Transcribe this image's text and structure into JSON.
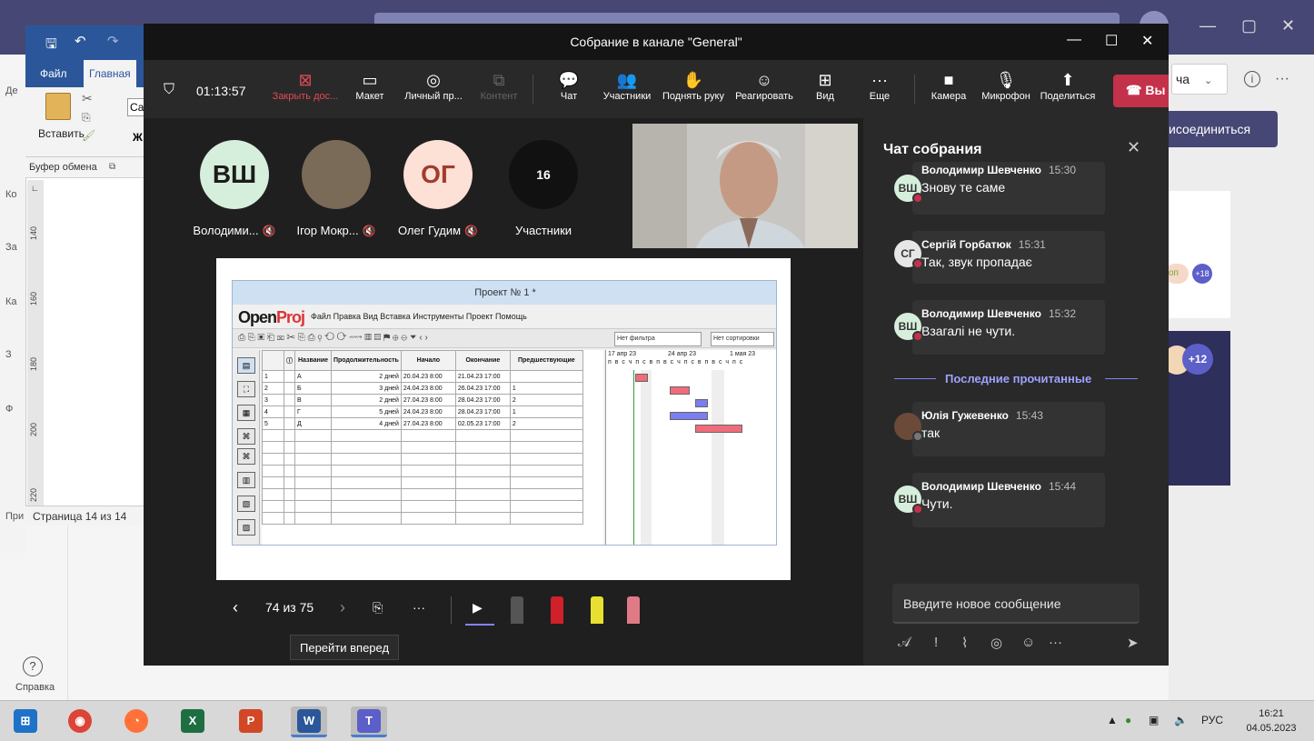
{
  "meeting": {
    "title": "Собрание в канале \"General\"",
    "timer": "01:13:57",
    "toolbar": {
      "stop_presenting": "Закрыть дос...",
      "layout": "Макет",
      "personal": "Личный пр...",
      "content": "Контент",
      "chat": "Чат",
      "participants": "Участники",
      "raise_hand": "Поднять руку",
      "react": "Реагировать",
      "view": "Вид",
      "more": "Еще",
      "camera": "Камера",
      "mic": "Микрофон",
      "share": "Поделиться",
      "leave": "Вы"
    },
    "participants": [
      {
        "initials": "ВШ",
        "name": "Володими...",
        "color": "#d6efdc",
        "text_color": "#1c1c1c"
      },
      {
        "initials": "",
        "name": "Ігор Мокр...",
        "color": "#7a6a58",
        "text_color": "#fff"
      },
      {
        "initials": "ОГ",
        "name": "Олег Гудим",
        "color": "#fde0d6",
        "text_color": "#a33b2a"
      },
      {
        "initials": "16",
        "name": "Участники",
        "color": "#111111",
        "text_color": "#fff"
      }
    ],
    "slide_nav": {
      "position": "74 из 75",
      "tooltip": "Перейти вперед"
    }
  },
  "openproj": {
    "title": "Проект № 1 *",
    "logo_a": "Open",
    "logo_b": "Proj",
    "menu": "Файл  Правка  Вид  Вставка  Инструменты  Проект  Помощь",
    "filter": "Нет фильтра",
    "sort": "Нет сортировки",
    "columns": [
      "",
      "ⓘ",
      "Название",
      "Продолжительность",
      "Начало",
      "Окончание",
      "Предшествующие"
    ],
    "rows": [
      [
        "1",
        "",
        "А",
        "2 дней",
        "20.04.23 8:00",
        "21.04.23 17:00",
        ""
      ],
      [
        "2",
        "",
        "Б",
        "3 дней",
        "24.04.23 8:00",
        "26.04.23 17:00",
        "1"
      ],
      [
        "3",
        "",
        "В",
        "2 дней",
        "27.04.23 8:00",
        "28.04.23 17:00",
        "2"
      ],
      [
        "4",
        "",
        "Г",
        "5 дней",
        "24.04.23 8:00",
        "28.04.23 17:00",
        "1"
      ],
      [
        "5",
        "",
        "Д",
        "4 дней",
        "27.04.23 8:00",
        "02.05.23 17:00",
        "2"
      ]
    ],
    "gantt_weeks": [
      "17 апр 23",
      "24 апр 23",
      "1 мая 23"
    ],
    "gantt_days": "п в с ч п с в п в с ч п с в п в с ч п с"
  },
  "chat": {
    "title": "Чат собрания",
    "messages": [
      {
        "initials": "ВШ",
        "author": "Володимир Шевченко",
        "time": "15:30",
        "text": "Знову те саме"
      },
      {
        "initials": "СГ",
        "author": "Сергій Горбатюк",
        "time": "15:31",
        "text": "Так, звук пропадає"
      },
      {
        "initials": "ВШ",
        "author": "Володимир Шевченко",
        "time": "15:32",
        "text": "Взагалі не чути."
      },
      {
        "initials": "",
        "author": "Юлія Гужевенко",
        "time": "15:43",
        "text": "так"
      },
      {
        "initials": "ВШ",
        "author": "Володимир Шевченко",
        "time": "15:44",
        "text": "Чути."
      }
    ],
    "last_read": "Последние прочитанные",
    "compose_placeholder": "Введите новое сообщение"
  },
  "word": {
    "tab_file": "Файл",
    "tab_home": "Главная",
    "paste": "Вставить",
    "clipboard": "Буфер обмена",
    "status": "Страница 14 из 14",
    "ruler": [
      "140",
      "160",
      "180",
      "200",
      "220"
    ],
    "side_labels": [
      "Де",
      "Ко",
      "За",
      "Ка",
      "З",
      "Ф",
      "При"
    ]
  },
  "teams": {
    "right_select": "ча",
    "join": "исоединиться",
    "op_badge": "оп",
    "plus18": "+18",
    "plus12": "+12",
    "help": "Справка"
  },
  "taskbar": {
    "lang": "РУС",
    "time": "16:21",
    "date": "04.05.2023"
  }
}
